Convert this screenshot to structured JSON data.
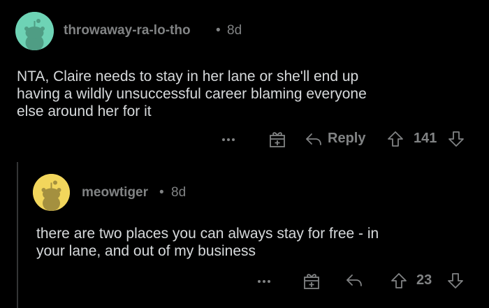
{
  "comments": [
    {
      "username": "throwaway-ra-lo-tho",
      "age": "8d",
      "body_lines": [
        "NTA, Claire needs to stay in her lane or she'll end up",
        "having a wildly unsuccessful career blaming everyone",
        "else around her for it"
      ],
      "reply_label": "Reply",
      "vote_count": "141",
      "avatar_color": "#6ed3b5"
    },
    {
      "username": "meowtiger",
      "age": "8d",
      "body_lines": [
        "there are two places you can always stay for free - in",
        "your lane, and out of my business"
      ],
      "vote_count": "23",
      "avatar_color": "#f2d65c"
    }
  ],
  "separator": "•",
  "colors": {
    "background": "#000000",
    "text": "#d7dadc",
    "muted": "#818384",
    "thread_line": "#343536"
  }
}
